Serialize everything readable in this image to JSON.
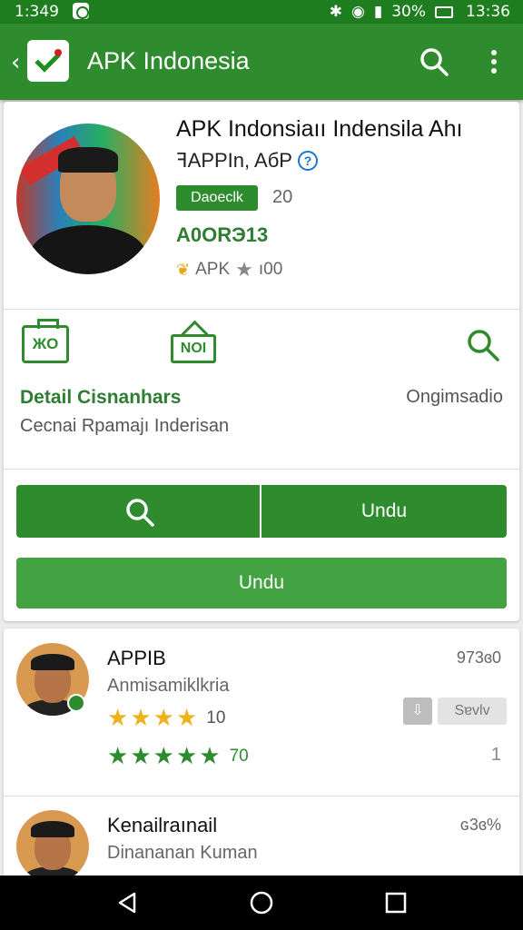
{
  "status": {
    "time": "1:349",
    "battery": "30%",
    "clock": "13:36"
  },
  "appbar": {
    "title": "APK Indonesia"
  },
  "app": {
    "title": "APK Indonsiaıı Indensila Ahı",
    "developer": "ꟻAPPIn, AбP",
    "badge": "Daoeclk",
    "badge_count": "20",
    "version": "A0ORЭ13",
    "rating_text": "APK",
    "rating_value": "ı00"
  },
  "features": {
    "box1": "ЖO",
    "box2": "NOI",
    "detail_title": "Detail Cisnanhars",
    "detail_right": "Ongimsadio",
    "detail_sub": "Cecnai Rpamajı Inderisan"
  },
  "buttons": {
    "split_right": "Undu",
    "full": "Undu"
  },
  "list": [
    {
      "name": "APPIB",
      "sub": "Anmisamiklkria",
      "count": "973ɞ0",
      "gold_val": "10",
      "green_val": "70",
      "mini": "⇩",
      "save": "Sɐvlv",
      "index": "1"
    },
    {
      "name": "Kenailraınail",
      "sub": "Dinananan Kuman",
      "count": "ɢ3ɞ%"
    }
  ]
}
